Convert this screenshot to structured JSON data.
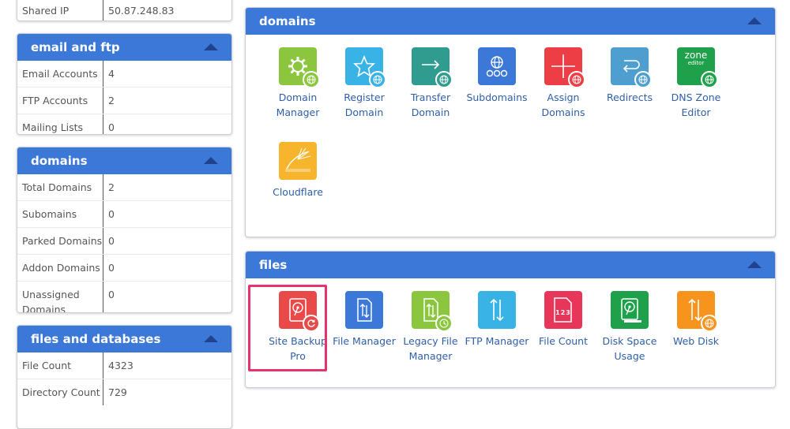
{
  "left": {
    "top_stat": {
      "label": "Shared IP",
      "value": "50.87.248.83"
    },
    "email_ftp": {
      "title": "email and ftp",
      "rows": [
        {
          "label": "Email Accounts",
          "value": "4"
        },
        {
          "label": "FTP Accounts",
          "value": "2"
        },
        {
          "label": "Mailing Lists",
          "value": "0"
        }
      ]
    },
    "domains": {
      "title": "domains",
      "rows": [
        {
          "label": "Total Domains",
          "value": "2"
        },
        {
          "label": "Subomains",
          "value": "0"
        },
        {
          "label": "Parked Domains",
          "value": "0"
        },
        {
          "label": "Addon Domains",
          "value": "0"
        },
        {
          "label": "Unassigned Domains",
          "value": "0"
        }
      ]
    },
    "files_db": {
      "title": "files and databases",
      "rows": [
        {
          "label": "File Count",
          "value": "4323"
        },
        {
          "label": "Directory Count",
          "value": "729"
        }
      ]
    }
  },
  "domains_panel": {
    "title": "domains",
    "items": [
      {
        "label": "Domain Manager",
        "icon": "gear-globe-icon",
        "color": "#8cc63f"
      },
      {
        "label": "Register Domain",
        "icon": "star-globe-icon",
        "color": "#39b3e6"
      },
      {
        "label": "Transfer Domain",
        "icon": "arrow-globe-icon",
        "color": "#2f9c8f"
      },
      {
        "label": "Subdomains",
        "icon": "sitemap-globe-icon",
        "color": "#3c78d8"
      },
      {
        "label": "Assign Domains",
        "icon": "plus-globe-icon",
        "color": "#ee3e45"
      },
      {
        "label": "Redirects",
        "icon": "redirect-globe-icon",
        "color": "#4e9fcf"
      },
      {
        "label": "DNS Zone Editor",
        "icon": "zone-editor-icon",
        "color": "#1fa04a",
        "tile_text": "zone",
        "tile_subtext": "editor"
      },
      {
        "label": "Cloudflare",
        "icon": "cloudflare-icon",
        "color": "#f6b52c"
      }
    ]
  },
  "files_panel": {
    "title": "files",
    "items": [
      {
        "label": "Site Backup Pro",
        "icon": "backup-disk-icon",
        "color": "#e84a4a"
      },
      {
        "label": "File Manager",
        "icon": "file-manager-icon",
        "color": "#3c78d8"
      },
      {
        "label": "Legacy File Manager",
        "icon": "legacy-file-manager-icon",
        "color": "#8cc63f"
      },
      {
        "label": "FTP Manager",
        "icon": "ftp-manager-icon",
        "color": "#39b3e6"
      },
      {
        "label": "File Count",
        "icon": "file-count-icon",
        "color": "#e8365a",
        "tile_text": "123"
      },
      {
        "label": "Disk Space Usage",
        "icon": "disk-space-icon",
        "color": "#1fa04a"
      },
      {
        "label": "Web Disk",
        "icon": "web-disk-icon",
        "color": "#f7941d"
      }
    ]
  }
}
